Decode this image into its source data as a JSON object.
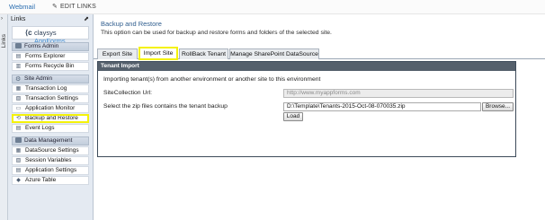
{
  "topbar": {
    "webmail": "Webmail",
    "edit_links": "EDIT LINKS"
  },
  "vtab": {
    "label": "Links"
  },
  "sidebar": {
    "header": "Links",
    "logo": {
      "mark": "⟨c",
      "brand": "claysys",
      "product": " AppForms"
    },
    "sections": [
      {
        "title": "Forms Admin",
        "items": [
          "Forms Explorer",
          "Forms Recycle Bin"
        ]
      },
      {
        "title": "Site Admin",
        "items": [
          "Transaction Log",
          "Transaction Settings",
          "Application Monitor",
          "Backup and Restore",
          "Event Logs"
        ]
      },
      {
        "title": "Data Management",
        "items": [
          "DataSource Settings",
          "Session Variables",
          "Application Settings",
          "Azure Table"
        ]
      }
    ]
  },
  "main": {
    "title": "Backup and Restore",
    "description": "This option can be used for backup and restore forms and folders of the selected site.",
    "tabs": [
      "Export Site",
      "Import Site",
      "RollBack Tenant",
      "Manage SharePoint DataSource"
    ],
    "active_tab": "Import Site",
    "panel": {
      "header": "Tenant Import",
      "intro": "Importing tenant(s) from another environment or another site to this environment",
      "url_label": "SiteCollection Url:",
      "url_value": "http://www.myappforms.com",
      "file_label": "Select the zip files contains the tenant backup",
      "file_value": "D:\\Template\\Tenants-2015-Oct-08-070035.zip",
      "browse_label": "Browse...",
      "load_label": "Load"
    }
  },
  "colors": {
    "highlight": "#f4f20a",
    "title_blue": "#2f5d8e",
    "panel_header": "#55606c"
  }
}
